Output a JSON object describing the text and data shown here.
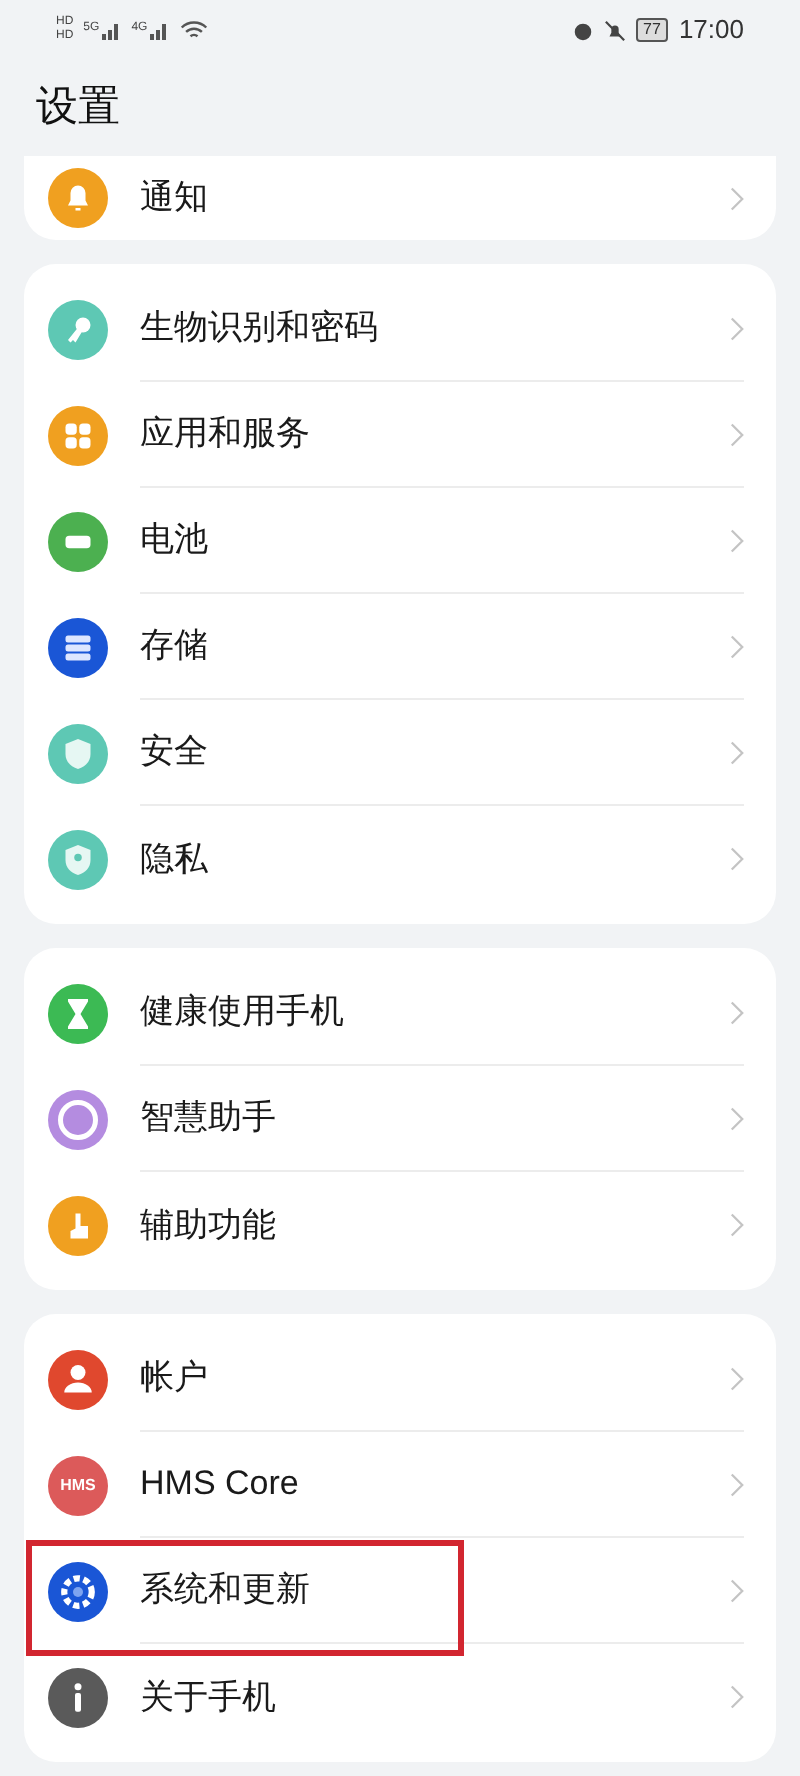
{
  "status_bar": {
    "sim_labels": [
      "HD",
      "HD"
    ],
    "networks": [
      "5G",
      "4G"
    ],
    "battery": "77",
    "time": "17:00"
  },
  "title": "设置",
  "groups": [
    {
      "cut_top": true,
      "items": [
        {
          "label": "通知",
          "kind": "bell",
          "color": "#f0a020",
          "highlighted": false
        }
      ]
    },
    {
      "cut_top": false,
      "items": [
        {
          "label": "生物识别和密码",
          "kind": "key",
          "color": "#5ec8b4",
          "highlighted": false
        },
        {
          "label": "应用和服务",
          "kind": "apps",
          "color": "#f0a020",
          "highlighted": false
        },
        {
          "label": "电池",
          "kind": "battery",
          "color": "#4cb050",
          "highlighted": false
        },
        {
          "label": "存储",
          "kind": "storage",
          "color": "#1a56d6",
          "highlighted": false
        },
        {
          "label": "安全",
          "kind": "shield",
          "color": "#5ec8b4",
          "highlighted": false
        },
        {
          "label": "隐私",
          "kind": "privacy",
          "color": "#5ec8b4",
          "highlighted": false
        }
      ]
    },
    {
      "cut_top": false,
      "items": [
        {
          "label": "健康使用手机",
          "kind": "hourglass",
          "color": "#3cba54",
          "highlighted": false
        },
        {
          "label": "智慧助手",
          "kind": "ring",
          "color": "#b48ce0",
          "highlighted": false
        },
        {
          "label": "辅助功能",
          "kind": "hand",
          "color": "#f0a020",
          "highlighted": false
        }
      ]
    },
    {
      "cut_top": false,
      "items": [
        {
          "label": "帐户",
          "kind": "person",
          "color": "#e0482e",
          "highlighted": false
        },
        {
          "label": "HMS Core",
          "kind": "text",
          "icon_text": "HMS",
          "color": "#dc5a5a",
          "highlighted": false
        },
        {
          "label": "系统和更新",
          "kind": "gear",
          "color": "#1a56d6",
          "highlighted": true
        },
        {
          "label": "关于手机",
          "kind": "info",
          "color": "#5a5a5a",
          "highlighted": false
        }
      ]
    }
  ]
}
